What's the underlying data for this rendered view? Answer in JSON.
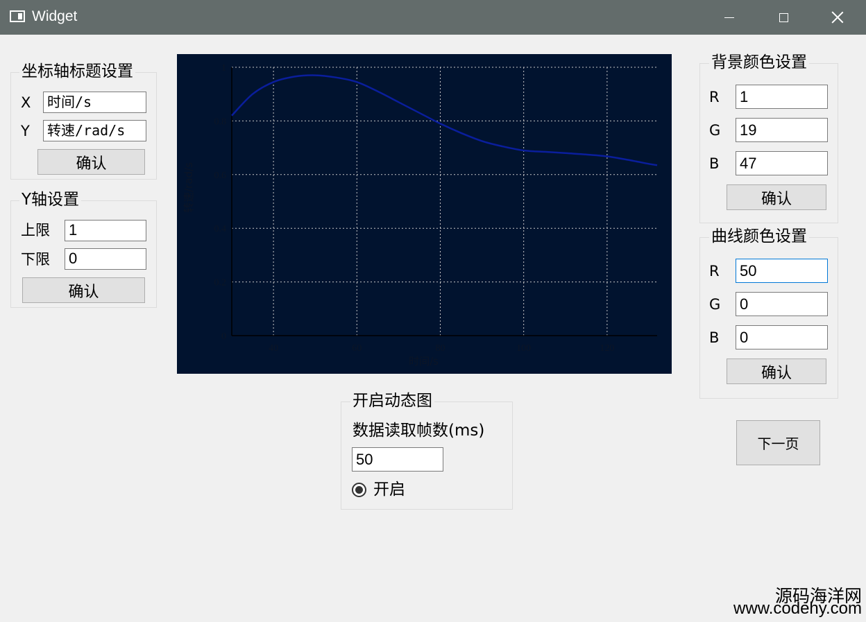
{
  "window": {
    "title": "Widget",
    "icon": "window-app-icon",
    "controls": [
      "minimize-icon",
      "maximize-icon",
      "close-icon"
    ],
    "titlebar_color": "#636c6b"
  },
  "axis_title": {
    "group_title": "坐标轴标题设置",
    "x_label": "X",
    "x_value": "时间/s",
    "y_label": "Y",
    "y_value": "转速/rad/s",
    "confirm": "确认"
  },
  "y_axis": {
    "group_title": "Y轴设置",
    "upper_label": "上限",
    "upper_value": "1",
    "lower_label": "下限",
    "lower_value": "0",
    "confirm": "确认"
  },
  "background_color": {
    "group_title": "背景颜色设置",
    "r_label": "R",
    "r_value": "1",
    "g_label": "G",
    "g_value": "19",
    "b_label": "B",
    "b_value": "47",
    "confirm": "确认"
  },
  "curve_color": {
    "group_title": "曲线颜色设置",
    "r_label": "R",
    "r_value": "50",
    "g_label": "G",
    "g_value": "0",
    "b_label": "B",
    "b_value": "0",
    "confirm": "确认"
  },
  "dynamic": {
    "group_title": "开启动态图",
    "frame_label": "数据读取帧数(ms)",
    "frame_value": "50",
    "radio_label": "开启",
    "radio_checked": true
  },
  "next_page": "下一页",
  "watermark": {
    "line1": "源码海洋网",
    "line2": "www.codehy.com"
  },
  "chart_data": {
    "type": "line",
    "background": "#01132f",
    "line_color": "#0a1e9c",
    "grid": true,
    "grid_style": "dotted",
    "xlabel": "时间/s",
    "ylabel": "转速/rad/s",
    "xlim": [
      30,
      132
    ],
    "ylim": [
      0,
      1
    ],
    "xticks": [
      "40",
      "60",
      "80",
      "100",
      "120"
    ],
    "yticks": [
      "0",
      "0.2",
      "0.4",
      "0.6",
      "0.8",
      "1"
    ],
    "x": [
      30,
      35,
      40,
      45,
      50,
      55,
      60,
      65,
      70,
      75,
      80,
      85,
      90,
      95,
      100,
      105,
      110,
      115,
      120,
      125,
      130,
      132
    ],
    "y": [
      0.82,
      0.9,
      0.945,
      0.965,
      0.97,
      0.962,
      0.945,
      0.91,
      0.87,
      0.83,
      0.79,
      0.755,
      0.725,
      0.705,
      0.69,
      0.685,
      0.68,
      0.675,
      0.668,
      0.655,
      0.64,
      0.635
    ]
  }
}
